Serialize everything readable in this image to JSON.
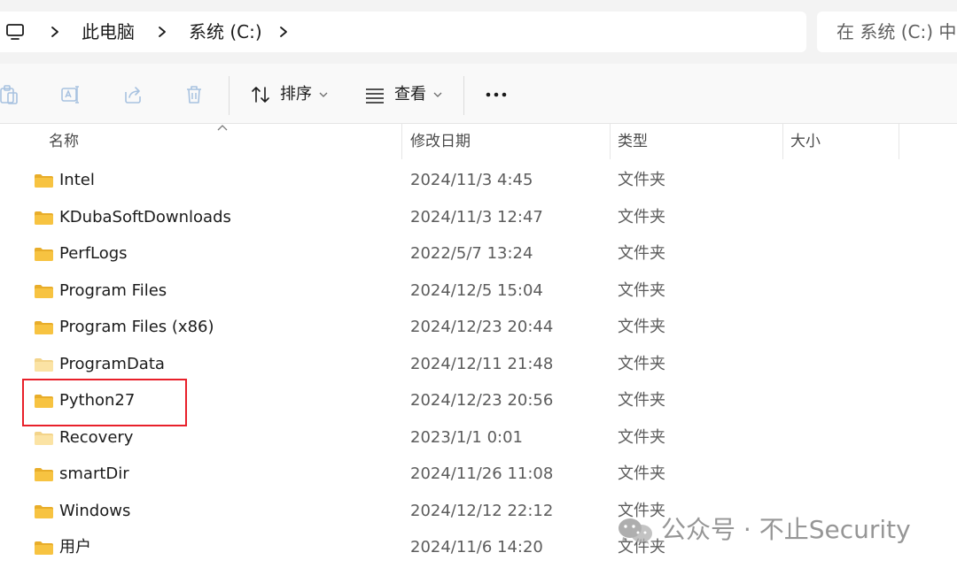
{
  "address_bar": {
    "breadcrumbs": [
      "此电脑",
      "系统 (C:)"
    ],
    "search_placeholder": "在 系统 (C:) 中搜"
  },
  "command_bar": {
    "icons": [
      "paste-icon",
      "rename-icon",
      "share-icon",
      "delete-icon"
    ],
    "sort_label": "排序",
    "view_label": "查看",
    "more_label": "···"
  },
  "columns": {
    "name": "名称",
    "modified": "修改日期",
    "type": "类型",
    "size": "大小"
  },
  "files": [
    {
      "name": "Intel",
      "modified": "2024/11/3 4:45",
      "type": "文件夹",
      "hidden": false
    },
    {
      "name": "KDubaSoftDownloads",
      "modified": "2024/11/3 12:47",
      "type": "文件夹",
      "hidden": false
    },
    {
      "name": "PerfLogs",
      "modified": "2022/5/7 13:24",
      "type": "文件夹",
      "hidden": false
    },
    {
      "name": "Program Files",
      "modified": "2024/12/5 15:04",
      "type": "文件夹",
      "hidden": false
    },
    {
      "name": "Program Files (x86)",
      "modified": "2024/12/23 20:44",
      "type": "文件夹",
      "hidden": false
    },
    {
      "name": "ProgramData",
      "modified": "2024/12/11 21:48",
      "type": "文件夹",
      "hidden": true
    },
    {
      "name": "Python27",
      "modified": "2024/12/23 20:56",
      "type": "文件夹",
      "hidden": false
    },
    {
      "name": "Recovery",
      "modified": "2023/1/1 0:01",
      "type": "文件夹",
      "hidden": true
    },
    {
      "name": "smartDir",
      "modified": "2024/11/26 11:08",
      "type": "文件夹",
      "hidden": false
    },
    {
      "name": "Windows",
      "modified": "2024/12/12 22:12",
      "type": "文件夹",
      "hidden": false
    },
    {
      "name": "用户",
      "modified": "2024/11/6 14:20",
      "type": "文件夹",
      "hidden": false
    }
  ],
  "highlighted_item": "Python27",
  "watermark": {
    "text": "公众号 · 不止Security"
  },
  "colors": {
    "folder": "#f7c341",
    "folder_hidden": "#fbe3a4",
    "highlight_border": "#e8202a",
    "accent_icon": "#4a79b6"
  }
}
